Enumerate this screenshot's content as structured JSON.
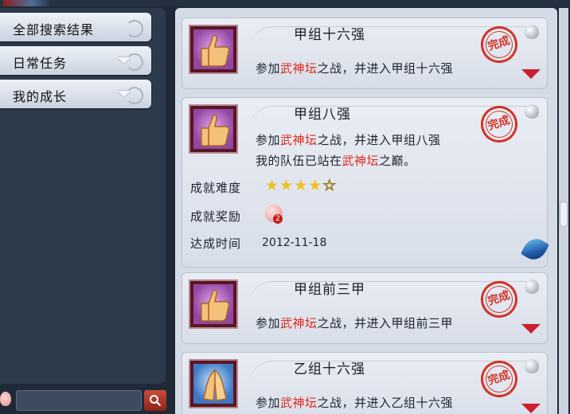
{
  "sidebar": {
    "items": [
      {
        "label": "全部搜索结果",
        "expandable": false
      },
      {
        "label": "日常任务",
        "expandable": true
      },
      {
        "label": "我的成长",
        "expandable": true
      }
    ],
    "search": {
      "placeholder": "",
      "value": ""
    }
  },
  "achievements": [
    {
      "title": "甲组十六强",
      "desc_pre": "参加",
      "desc_hl": "武神坛",
      "desc_post": "之战，并进入甲组十六强",
      "stamp": "完成",
      "expanded": false,
      "icon": "thumbs-up-icon"
    },
    {
      "title": "甲组八强",
      "desc_pre": "参加",
      "desc_hl": "武神坛",
      "desc_post": "之战，并进入甲组八强",
      "desc2_pre": "我的队伍已站在",
      "desc2_hl": "武神坛",
      "desc2_post": "之巅。",
      "stamp": "完成",
      "expanded": true,
      "icon": "thumbs-up-icon",
      "details": {
        "difficulty_label": "成就难度",
        "difficulty_stars": 4,
        "difficulty_max": 5,
        "reward_label": "成就奖励",
        "reward_count": "2",
        "date_label": "达成时间",
        "date_value": "2012-11-18"
      }
    },
    {
      "title": "甲组前三甲",
      "desc_pre": "参加",
      "desc_hl": "武神坛",
      "desc_post": "之战，并进入甲组前三甲",
      "stamp": "完成",
      "expanded": false,
      "icon": "thumbs-up-icon"
    },
    {
      "title": "乙组十六强",
      "desc_pre": "参加",
      "desc_hl": "武神坛",
      "desc_post": "之战，并进入乙组十六强",
      "stamp": "完成",
      "expanded": false,
      "icon": "praying-hands-icon"
    }
  ],
  "colors": {
    "highlight": "#e02a1c",
    "stamp": "#d03528",
    "arrow": "#c8202c",
    "star": "#f0c020"
  },
  "scrollbar": {
    "position": 0.5
  }
}
